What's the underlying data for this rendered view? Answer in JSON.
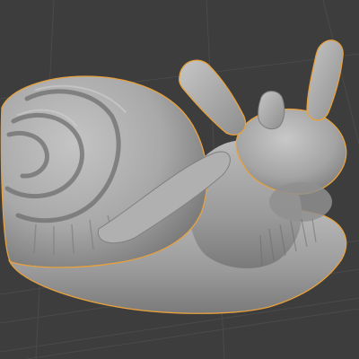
{
  "viewport": {
    "mode": "sculpt",
    "background_color": "#3d3d3d",
    "grid_color": "#4a4a4a",
    "selection_outline_color": "#e8a13c"
  },
  "model": {
    "object": "snail-sculpt",
    "surface_color": "#a9a9a9",
    "shading": "solid-matcap-gray",
    "selected": true
  }
}
